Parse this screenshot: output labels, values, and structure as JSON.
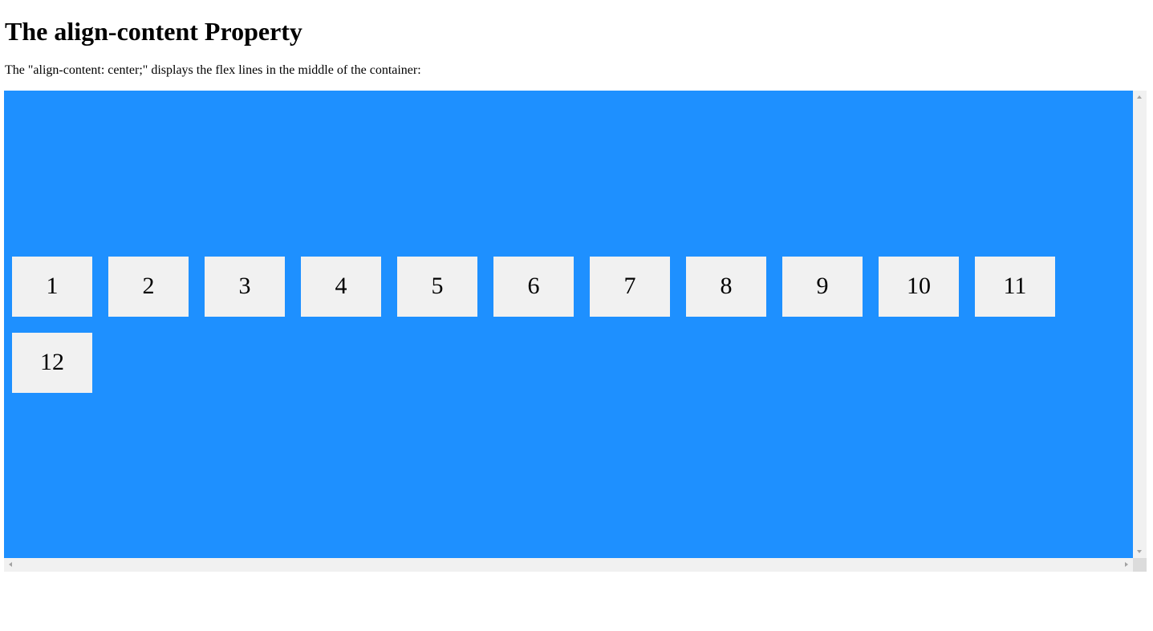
{
  "heading": "The align-content Property",
  "description": "The \"align-content: center;\" displays the flex lines in the middle of the container:",
  "container": {
    "background_color": "#1e90ff",
    "item_background_color": "#f1f1f1",
    "items": [
      "1",
      "2",
      "3",
      "4",
      "5",
      "6",
      "7",
      "8",
      "9",
      "10",
      "11",
      "12"
    ]
  },
  "scrollbars": {
    "vertical": {
      "up_icon": "arrow-up-icon",
      "down_icon": "arrow-down-icon"
    },
    "horizontal": {
      "left_icon": "arrow-left-icon",
      "right_icon": "arrow-right-icon"
    }
  }
}
